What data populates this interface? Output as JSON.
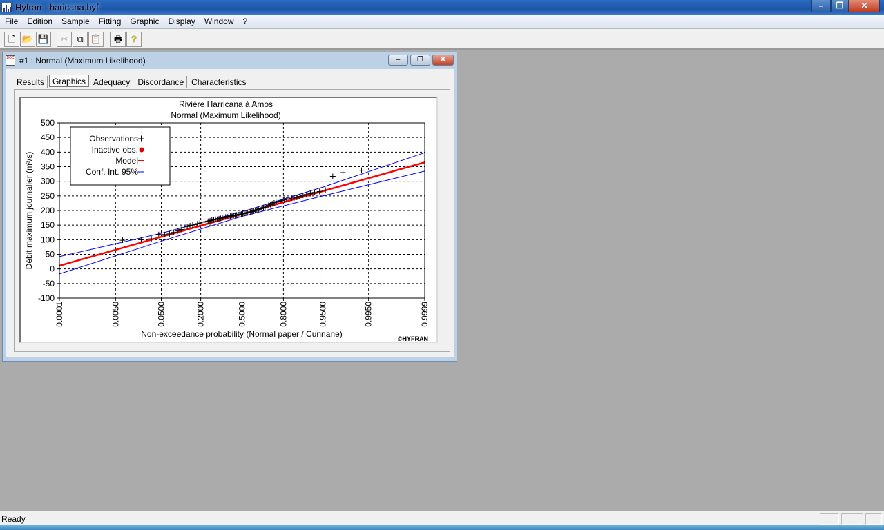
{
  "app": {
    "title": "Hyfran - haricana.hyf"
  },
  "menu": [
    "File",
    "Edition",
    "Sample",
    "Fitting",
    "Graphic",
    "Display",
    "Window",
    "?"
  ],
  "toolbar": {
    "icons": [
      "new-icon",
      "open-icon",
      "save-icon",
      "cut-icon",
      "copy-icon",
      "paste-icon",
      "print-icon",
      "help-icon"
    ]
  },
  "child_window": {
    "title": "#1 : Normal (Maximum Likelihood)",
    "tabs": [
      "Results",
      "Graphics",
      "Adequacy",
      "Discordance",
      "Characteristics"
    ],
    "active_tab": "Graphics"
  },
  "status": {
    "text": "Ready"
  },
  "colors": {
    "model": "#ff0000",
    "conf_int": "#0000ff",
    "observations": "#000000",
    "inactive": "#e00000"
  },
  "chart_data": {
    "type": "scatter",
    "title": "Rivière Harricana à Amos",
    "subtitle": "Normal (Maximum Likelihood)",
    "xlabel": "Non-exceedance probability (Normal paper / Cunnane)",
    "ylabel": "Débit maximum journalier (m³/s)",
    "copyright": "©HYFRAN",
    "x_scale": "normal-probability",
    "x_ticks": [
      "0.0001",
      "0.0050",
      "0.0500",
      "0.2000",
      "0.5000",
      "0.8000",
      "0.9500",
      "0.9950",
      "0.9999"
    ],
    "y_ticks": [
      "500",
      "450",
      "400",
      "350",
      "300",
      "250",
      "200",
      "150",
      "100",
      "50",
      "0",
      "-50",
      "-100"
    ],
    "ylim": [
      -100,
      500
    ],
    "xlim": [
      0.0001,
      0.9999
    ],
    "grid": true,
    "legend_position": "top-left",
    "legend": [
      "Observations",
      "Inactive obs.",
      "Model",
      "Conf. Int. 95%"
    ],
    "observations": {
      "x": [
        0.0075,
        0.02,
        0.0324,
        0.0449,
        0.0574,
        0.0698,
        0.0823,
        0.0948,
        0.1072,
        0.1197,
        0.1322,
        0.1446,
        0.1571,
        0.1696,
        0.182,
        0.1945,
        0.207,
        0.2195,
        0.2319,
        0.2444,
        0.2569,
        0.2693,
        0.2818,
        0.2943,
        0.3067,
        0.3192,
        0.3317,
        0.3441,
        0.3566,
        0.3691,
        0.3815,
        0.394,
        0.4065,
        0.419,
        0.4314,
        0.4439,
        0.4564,
        0.4688,
        0.4813,
        0.4938,
        0.5062,
        0.5187,
        0.5312,
        0.5436,
        0.5561,
        0.5686,
        0.581,
        0.5935,
        0.606,
        0.6185,
        0.6309,
        0.6434,
        0.6559,
        0.6683,
        0.6808,
        0.6933,
        0.7057,
        0.7182,
        0.7307,
        0.7431,
        0.7556,
        0.7681,
        0.7805,
        0.793,
        0.8055,
        0.818,
        0.8304,
        0.8429,
        0.8554,
        0.8678,
        0.8803,
        0.8928,
        0.9052,
        0.9177,
        0.9302,
        0.9426,
        0.9551,
        0.9676,
        0.98,
        0.9925
      ],
      "y": [
        98,
        100,
        103,
        118,
        118,
        120,
        125,
        130,
        135,
        140,
        145,
        148,
        150,
        152,
        155,
        157,
        160,
        160,
        162,
        163,
        165,
        167,
        168,
        170,
        170,
        172,
        173,
        175,
        176,
        178,
        179,
        180,
        181,
        182,
        183,
        184,
        185,
        186,
        187,
        188,
        189,
        190,
        191,
        192,
        193,
        195,
        196,
        198,
        200,
        202,
        204,
        206,
        208,
        210,
        212,
        215,
        218,
        220,
        223,
        226,
        228,
        230,
        232,
        234,
        236,
        238,
        240,
        242,
        243,
        245,
        248,
        252,
        255,
        258,
        262,
        265,
        270,
        317,
        330,
        338
      ]
    },
    "model": {
      "x": [
        0.0001,
        0.9999
      ],
      "y": [
        11,
        365
      ]
    },
    "conf_upper": {
      "x": [
        0.0001,
        0.05,
        0.5,
        0.95,
        0.9999
      ],
      "y": [
        42,
        122,
        196,
        280,
        398
      ]
    },
    "conf_lower": {
      "x": [
        0.0001,
        0.05,
        0.5,
        0.95,
        0.9999
      ],
      "y": [
        -17,
        95,
        180,
        250,
        335
      ]
    }
  }
}
